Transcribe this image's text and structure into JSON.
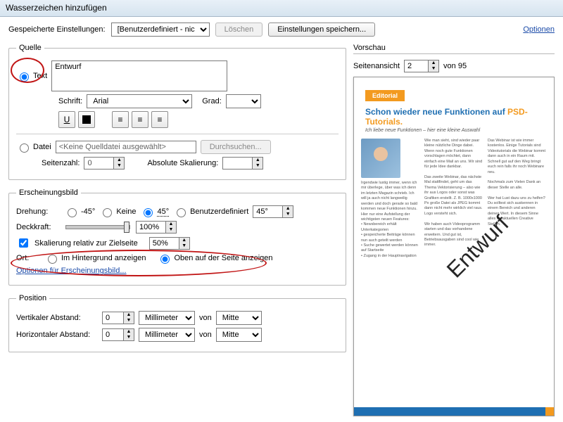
{
  "window_title": "Wasserzeichen hinzufügen",
  "top": {
    "saved_label": "Gespeicherte Einstellungen:",
    "saved_value": "[Benutzerdefiniert - nicht gespeichert]",
    "delete": "Löschen",
    "save_settings": "Einstellungen speichern...",
    "options": "Optionen"
  },
  "source": {
    "legend": "Quelle",
    "text_radio": "Text",
    "text_value": "Entwurf",
    "font_label": "Schrift:",
    "font_value": "Arial",
    "size_label": "Grad:",
    "size_value": "",
    "underline": "U",
    "file_radio": "Datei",
    "file_value": "<Keine Quelldatei ausgewählt>",
    "browse": "Durchsuchen...",
    "pagecount_label": "Seitenzahl:",
    "pagecount_value": "0",
    "abs_scale_label": "Absolute Skalierung:",
    "abs_scale_value": ""
  },
  "appearance": {
    "legend": "Erscheinungsbild",
    "rotation_label": "Drehung:",
    "rot_neg45": "-45°",
    "rot_none": "Keine",
    "rot_45": "45°",
    "rot_custom": "Benutzerdefiniert",
    "rot_custom_val": "45°",
    "opacity_label": "Deckkraft:",
    "opacity_value": "100%",
    "rel_scale_check": "Skalierung relativ zur Zielseite",
    "rel_scale_value": "50%",
    "location_label": "Ort:",
    "loc_behind": "Im Hintergrund anzeigen",
    "loc_top": "Oben auf der Seite anzeigen",
    "appearance_options": "Optionen für Erscheinungsbild..."
  },
  "position": {
    "legend": "Position",
    "vdist_label": "Vertikaler Abstand:",
    "vdist_value": "0",
    "vdist_unit": "Millimeter",
    "vdist_from": "von",
    "vdist_ref": "Mitte",
    "hdist_label": "Horizontaler Abstand:",
    "hdist_value": "0",
    "hdist_unit": "Millimeter",
    "hdist_from": "von",
    "hdist_ref": "Mitte"
  },
  "preview": {
    "legend": "Vorschau",
    "page_label": "Seitenansicht",
    "page_value": "2",
    "of": "von 95",
    "editorial": "Editorial",
    "headline_a": "Schon wieder neue Funktionen auf ",
    "headline_b": "PSD-Tutorials.",
    "subhead": "Ich liebe neue Funktionen – hier eine kleine Auswahl",
    "watermark": "Entwurf"
  }
}
